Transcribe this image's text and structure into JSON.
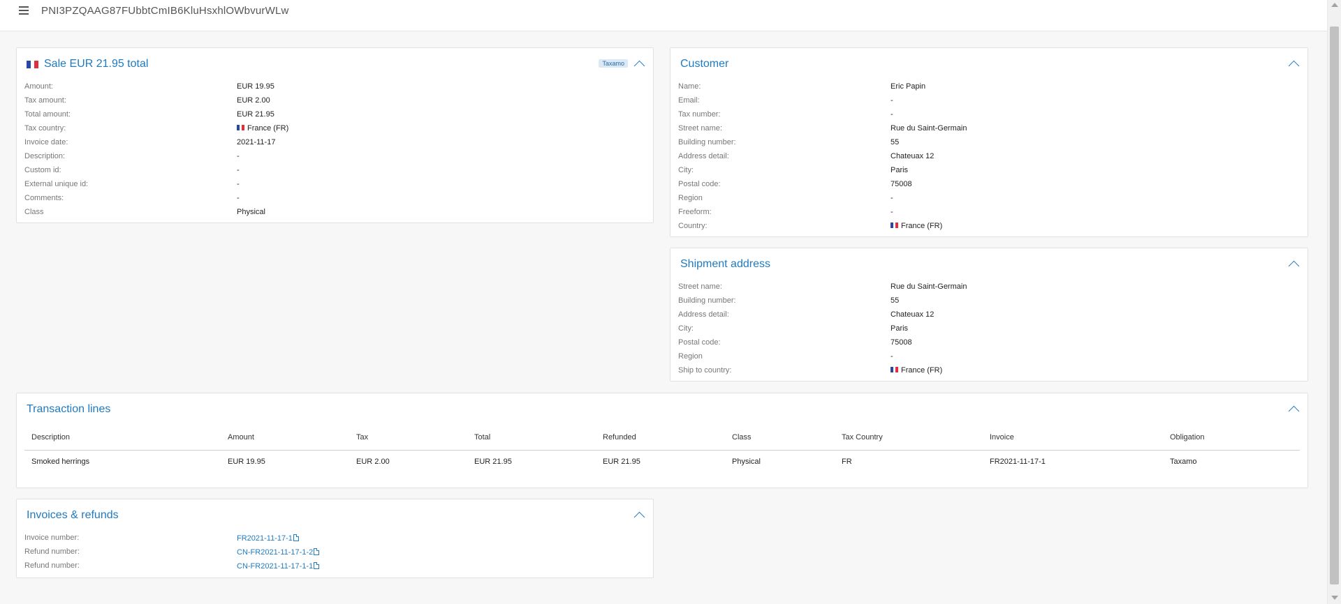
{
  "header": {
    "title": "PNI3PZQAAG87FUbbtCmIB6KluHsxhlOWbvurWLw",
    "menu_icon": "hamburger-icon"
  },
  "sale": {
    "title": "Sale EUR 21.95 total",
    "badge": "Taxamo",
    "flag_colors": [
      "#2848a8",
      "#ffffff",
      "#e03040"
    ],
    "rows": [
      {
        "label": "Amount:",
        "value": "EUR 19.95"
      },
      {
        "label": "Tax amount:",
        "value": "EUR 2.00"
      },
      {
        "label": "Total amount:",
        "value": "EUR 21.95"
      },
      {
        "label": "Tax country:",
        "value": "France (FR)"
      },
      {
        "label": "Invoice date:",
        "value": "2021-11-17"
      },
      {
        "label": "Description:",
        "value": "-"
      },
      {
        "label": "Custom id:",
        "value": "-"
      },
      {
        "label": "External unique id:",
        "value": "-"
      },
      {
        "label": "Comments:",
        "value": "-"
      },
      {
        "label": "Class",
        "value": "Physical"
      }
    ]
  },
  "customer": {
    "title": "Customer",
    "rows": [
      {
        "label": "Name:",
        "value": "Eric Papin"
      },
      {
        "label": "Email:",
        "value": "-"
      },
      {
        "label": "Tax number:",
        "value": "-"
      },
      {
        "label": "Street name:",
        "value": "Rue du Saint-Germain"
      },
      {
        "label": "Building number:",
        "value": "55"
      },
      {
        "label": "Address detail:",
        "value": "Chateuax 12"
      },
      {
        "label": "City:",
        "value": "Paris"
      },
      {
        "label": "Postal code:",
        "value": "75008"
      },
      {
        "label": "Region",
        "value": "-"
      },
      {
        "label": "Freeform:",
        "value": "-"
      },
      {
        "label": "Country:",
        "value": "France (FR)"
      }
    ]
  },
  "shipment": {
    "title": "Shipment address",
    "rows": [
      {
        "label": "Street name:",
        "value": "Rue du Saint-Germain"
      },
      {
        "label": "Building number:",
        "value": "55"
      },
      {
        "label": "Address detail:",
        "value": "Chateuax 12"
      },
      {
        "label": "City:",
        "value": "Paris"
      },
      {
        "label": "Postal code:",
        "value": "75008"
      },
      {
        "label": "Region",
        "value": "-"
      },
      {
        "label": "Ship to country:",
        "value": "France (FR)"
      }
    ]
  },
  "transactions": {
    "title": "Transaction lines",
    "columns": [
      "Description",
      "Amount",
      "Tax",
      "Total",
      "Refunded",
      "Class",
      "Tax Country",
      "Invoice",
      "Obligation"
    ],
    "rows": [
      [
        "Smoked herrings",
        "EUR 19.95",
        "EUR 2.00",
        "EUR 21.95",
        "EUR 21.95",
        "Physical",
        "FR",
        "FR2021-11-17-1",
        "Taxamo"
      ]
    ]
  },
  "invoices": {
    "title": "Invoices & refunds",
    "rows": [
      {
        "label": "Invoice number:",
        "value": "FR2021-11-17-1"
      },
      {
        "label": "Refund number:",
        "value": "CN-FR2021-11-17-1-2"
      },
      {
        "label": "Refund number:",
        "value": "CN-FR2021-11-17-1-1"
      }
    ]
  },
  "colors": {
    "accent": "#1f7ac1",
    "badge_bg": "#dbe9f6",
    "panel_border": "#e1e1e1"
  }
}
